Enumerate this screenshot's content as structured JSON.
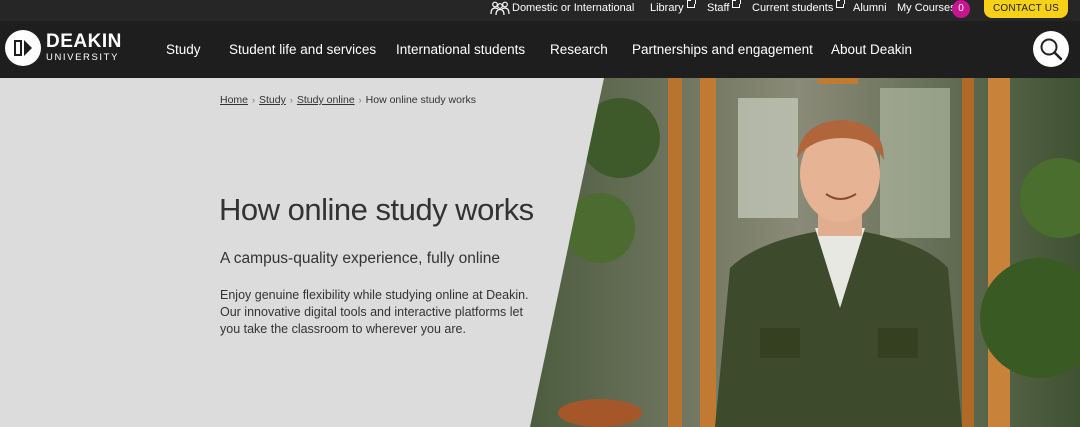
{
  "utility": {
    "audience": "Domestic or International",
    "library": "Library",
    "staff": "Staff",
    "current_students": "Current students",
    "alumni": "Alumni",
    "my_courses": "My Courses",
    "my_courses_count": "0",
    "contact": "CONTACT US"
  },
  "brand": {
    "word": "DEAKIN",
    "sub": "UNIVERSITY"
  },
  "nav": {
    "items": [
      {
        "label": "Study"
      },
      {
        "label": "Student life and services"
      },
      {
        "label": "International students"
      },
      {
        "label": "Research"
      },
      {
        "label": "Partnerships and engagement"
      },
      {
        "label": "About Deakin"
      }
    ]
  },
  "breadcrumb": {
    "items": [
      "Home",
      "Study",
      "Study online"
    ],
    "current": "How online study works"
  },
  "hero": {
    "title": "How online study works",
    "subtitle": "A campus-quality experience, fully online",
    "body": "Enjoy genuine flexibility while studying online at Deakin. Our innovative digital tools and interactive platforms let you take the classroom to wherever you are."
  },
  "colors": {
    "utility_bg": "#262626",
    "nav_bg": "#1e1e1e",
    "accent_yellow": "#f7d117",
    "badge_magenta": "#c7158f",
    "hero_bg": "#dcdcdc"
  }
}
